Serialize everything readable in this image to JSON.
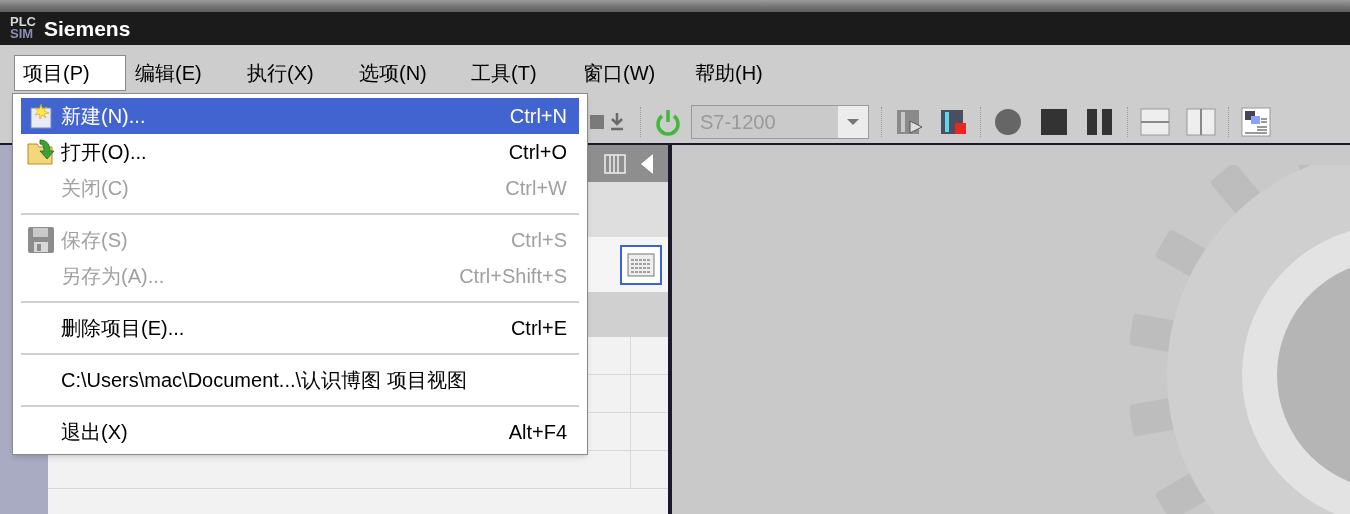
{
  "window": {
    "title": "Siemens",
    "logo": [
      "PLC",
      "SIM"
    ]
  },
  "menu_bar": [
    {
      "label": "项目(P)",
      "selected": true
    },
    {
      "label": "编辑(E)",
      "selected": false
    },
    {
      "label": "执行(X)",
      "selected": false
    },
    {
      "label": "选项(N)",
      "selected": false
    },
    {
      "label": "工具(T)",
      "selected": false
    },
    {
      "label": "窗口(W)",
      "selected": false
    },
    {
      "label": "帮助(H)",
      "selected": false
    }
  ],
  "project_menu": [
    {
      "kind": "item",
      "label": "新建(N)...",
      "shortcut": "Ctrl+N",
      "disabled": false,
      "selected": true
    },
    {
      "kind": "item",
      "label": "打开(O)...",
      "shortcut": "Ctrl+O",
      "disabled": false,
      "selected": false
    },
    {
      "kind": "item",
      "label": "关闭(C)",
      "shortcut": "Ctrl+W",
      "disabled": true,
      "selected": false
    },
    {
      "kind": "separator"
    },
    {
      "kind": "item",
      "label": "保存(S)",
      "shortcut": "Ctrl+S",
      "disabled": true,
      "selected": false
    },
    {
      "kind": "item",
      "label": "另存为(A)...",
      "shortcut": "Ctrl+Shift+S",
      "disabled": true,
      "selected": false
    },
    {
      "kind": "separator"
    },
    {
      "kind": "item",
      "label": "删除项目(E)...",
      "shortcut": "Ctrl+E",
      "disabled": false,
      "selected": false
    },
    {
      "kind": "separator"
    },
    {
      "kind": "item",
      "label": "C:\\Users\\mac\\Document...\\认识博图 项目视图",
      "disabled": false,
      "selected": false
    },
    {
      "kind": "separator"
    },
    {
      "kind": "item",
      "label": "退出(X)",
      "shortcut": "Alt+F4",
      "disabled": false,
      "selected": false
    }
  ],
  "toolbar": {
    "cpu_select": {
      "value": "S7-1200",
      "disabled": true
    }
  }
}
